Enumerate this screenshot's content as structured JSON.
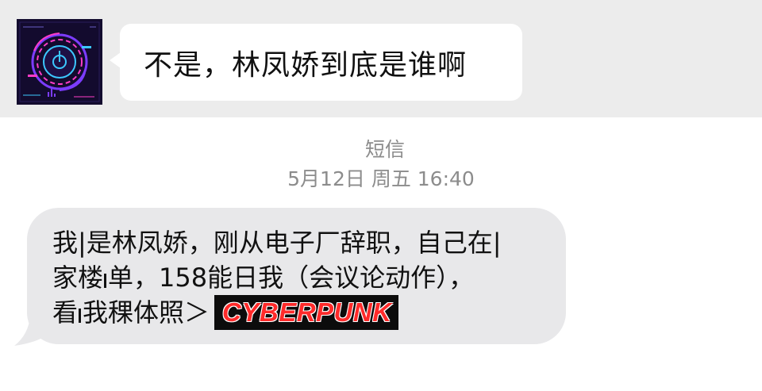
{
  "incoming_message": {
    "text": "不是，林凤娇到底是谁啊"
  },
  "sms_header": {
    "label": "短信",
    "timestamp": "5月12日 周五 16:40"
  },
  "sms_message": {
    "line1": "我|是林凤娇，刚从电子厂辞职，自己在|",
    "line2_a": "家楼",
    "line2_b": "单，158能日我（会议论动作），",
    "line3_a": "看",
    "line3_b": "我稞体照＞",
    "link_text": "CYBERPUNK"
  },
  "colors": {
    "top_background": "#ececec",
    "bubble_gray": "#e8e8ea",
    "link_text": "#ff2a2a",
    "link_background": "#0c0c0c",
    "timestamp_gray": "#8c8c8c"
  },
  "icons": {
    "avatar": "cyberpunk-dial-avatar-icon"
  }
}
